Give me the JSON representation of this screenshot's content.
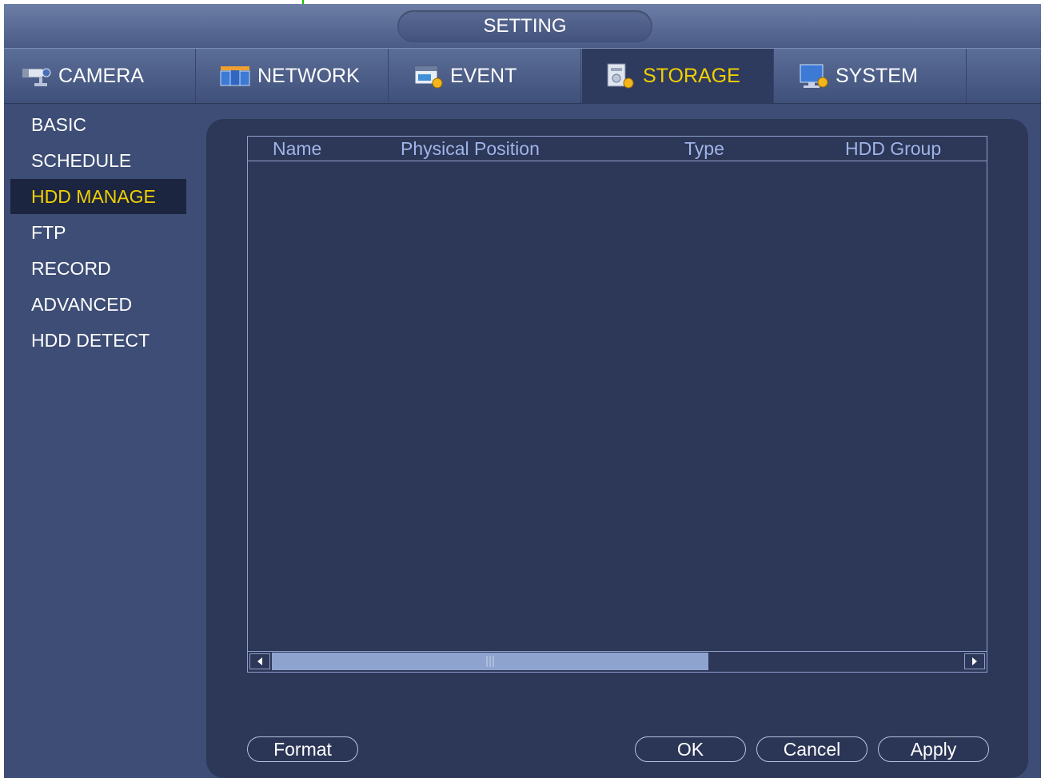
{
  "window": {
    "title": "SETTING"
  },
  "tabs": [
    {
      "label": "CAMERA",
      "icon": "camera-icon",
      "active": false
    },
    {
      "label": "NETWORK",
      "icon": "network-icon",
      "active": false
    },
    {
      "label": "EVENT",
      "icon": "event-icon",
      "active": false
    },
    {
      "label": "STORAGE",
      "icon": "storage-icon",
      "active": true
    },
    {
      "label": "SYSTEM",
      "icon": "system-icon",
      "active": false
    }
  ],
  "sidebar": {
    "items": [
      {
        "label": "BASIC",
        "active": false
      },
      {
        "label": "SCHEDULE",
        "active": false
      },
      {
        "label": "HDD MANAGE",
        "active": true
      },
      {
        "label": "FTP",
        "active": false
      },
      {
        "label": "RECORD",
        "active": false
      },
      {
        "label": "ADVANCED",
        "active": false
      },
      {
        "label": "HDD DETECT",
        "active": false
      }
    ]
  },
  "hdd_table": {
    "columns": [
      "Name",
      "Physical Position",
      "Type",
      "HDD Group"
    ],
    "rows": []
  },
  "buttons": {
    "format": "Format",
    "ok": "OK",
    "cancel": "Cancel",
    "apply": "Apply"
  },
  "colors": {
    "accent_active": "#f2d000",
    "background": "#3d4d75",
    "panel": "#2d3757",
    "header_text": "#9fb4e8"
  }
}
